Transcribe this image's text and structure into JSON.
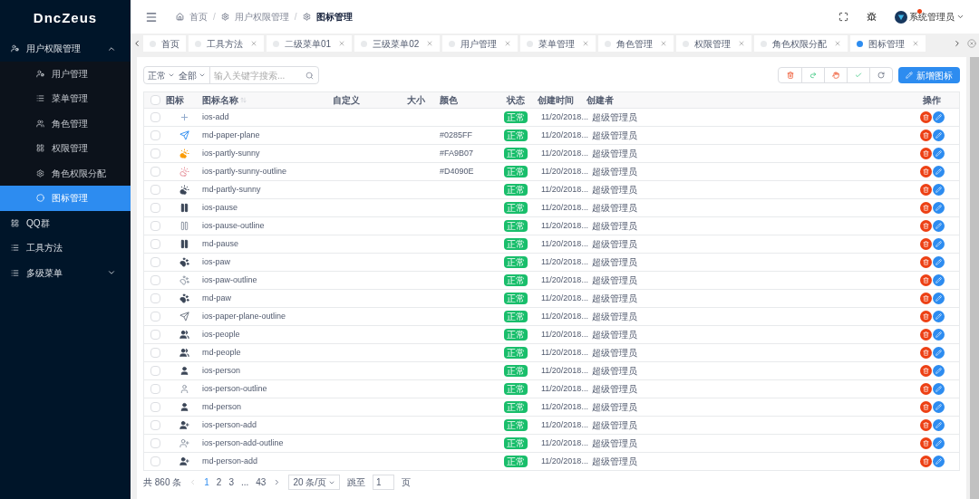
{
  "app": {
    "logo": "DncZeus"
  },
  "sidebar": {
    "items": [
      {
        "label": "用户权限管理",
        "expanded": true,
        "selected": false,
        "children": [
          {
            "label": "用户管理",
            "selected": false
          },
          {
            "label": "菜单管理",
            "selected": false
          },
          {
            "label": "角色管理",
            "selected": false
          },
          {
            "label": "权限管理",
            "selected": false
          },
          {
            "label": "角色权限分配",
            "selected": false
          },
          {
            "label": "图标管理",
            "selected": true
          }
        ]
      },
      {
        "label": "QQ群",
        "selected": false
      },
      {
        "label": "工具方法",
        "selected": false
      },
      {
        "label": "多级菜单",
        "expanded": false,
        "selected": false
      }
    ]
  },
  "header": {
    "breadcrumbs": [
      "首页",
      "用户权限管理",
      "图标管理"
    ],
    "separators": [
      "/",
      "/"
    ],
    "user": "系统管理员",
    "has_notification": true
  },
  "tabs": [
    {
      "label": "首页",
      "selected": false,
      "closable": false
    },
    {
      "label": "工具方法",
      "selected": false,
      "closable": true
    },
    {
      "label": "二级菜单01",
      "selected": false,
      "closable": true
    },
    {
      "label": "三级菜单02",
      "selected": false,
      "closable": true
    },
    {
      "label": "用户管理",
      "selected": false,
      "closable": true
    },
    {
      "label": "菜单管理",
      "selected": false,
      "closable": true
    },
    {
      "label": "角色管理",
      "selected": false,
      "closable": true
    },
    {
      "label": "权限管理",
      "selected": false,
      "closable": true
    },
    {
      "label": "角色权限分配",
      "selected": false,
      "closable": true
    },
    {
      "label": "图标管理",
      "selected": true,
      "closable": true
    }
  ],
  "filters": {
    "status": "正常",
    "scope": "全部",
    "search": {
      "placeholder": "输入关键字搜索..."
    }
  },
  "toolbar": {
    "add_button": "新增图标"
  },
  "table": {
    "select_all": {
      "checked": false
    },
    "columns": [
      "图标",
      "图标名称",
      "自定义",
      "大小",
      "颜色",
      "状态",
      "创建时间",
      "创建者",
      "操作"
    ],
    "rows": [
      {
        "checked": false,
        "name": "ios-add",
        "status": "正常",
        "created": "11/20/2018...",
        "creator": "超级管理员"
      },
      {
        "checked": false,
        "name": "md-paper-plane",
        "color_value": "#0285FF",
        "status": "正常",
        "created": "11/20/2018...",
        "creator": "超级管理员"
      },
      {
        "checked": false,
        "name": "ios-partly-sunny",
        "color_value": "#FA9B07",
        "status": "正常",
        "created": "11/20/2018...",
        "creator": "超级管理员"
      },
      {
        "checked": false,
        "name": "ios-partly-sunny-outline",
        "color_value": "#D4090E",
        "status": "正常",
        "created": "11/20/2018...",
        "creator": "超级管理员"
      },
      {
        "checked": false,
        "name": "md-partly-sunny",
        "status": "正常",
        "created": "11/20/2018...",
        "creator": "超级管理员"
      },
      {
        "checked": false,
        "name": "ios-pause",
        "status": "正常",
        "created": "11/20/2018...",
        "creator": "超级管理员"
      },
      {
        "checked": false,
        "name": "ios-pause-outline",
        "status": "正常",
        "created": "11/20/2018...",
        "creator": "超级管理员"
      },
      {
        "checked": false,
        "name": "md-pause",
        "status": "正常",
        "created": "11/20/2018...",
        "creator": "超级管理员"
      },
      {
        "checked": false,
        "name": "ios-paw",
        "status": "正常",
        "created": "11/20/2018...",
        "creator": "超级管理员"
      },
      {
        "checked": false,
        "name": "ios-paw-outline",
        "status": "正常",
        "created": "11/20/2018...",
        "creator": "超级管理员"
      },
      {
        "checked": false,
        "name": "md-paw",
        "status": "正常",
        "created": "11/20/2018...",
        "creator": "超级管理员"
      },
      {
        "checked": false,
        "name": "ios-paper-plane-outline",
        "status": "正常",
        "created": "11/20/2018...",
        "creator": "超级管理员"
      },
      {
        "checked": false,
        "name": "ios-people",
        "status": "正常",
        "created": "11/20/2018...",
        "creator": "超级管理员"
      },
      {
        "checked": false,
        "name": "md-people",
        "status": "正常",
        "created": "11/20/2018...",
        "creator": "超级管理员"
      },
      {
        "checked": false,
        "name": "ios-person",
        "status": "正常",
        "created": "11/20/2018...",
        "creator": "超级管理员"
      },
      {
        "checked": false,
        "name": "ios-person-outline",
        "status": "正常",
        "created": "11/20/2018...",
        "creator": "超级管理员"
      },
      {
        "checked": false,
        "name": "md-person",
        "status": "正常",
        "created": "11/20/2018...",
        "creator": "超级管理员"
      },
      {
        "checked": false,
        "name": "ios-person-add",
        "status": "正常",
        "created": "11/20/2018...",
        "creator": "超级管理员"
      },
      {
        "checked": false,
        "name": "ios-person-add-outline",
        "status": "正常",
        "created": "11/20/2018...",
        "creator": "超级管理员"
      },
      {
        "checked": false,
        "name": "md-person-add",
        "status": "正常",
        "created": "11/20/2018...",
        "creator": "超级管理员"
      }
    ]
  },
  "pagination": {
    "total": "共 860 条",
    "pages": [
      {
        "label": "1",
        "selected": true
      },
      {
        "label": "2",
        "selected": false
      },
      {
        "label": "3",
        "selected": false
      },
      {
        "label": "...",
        "selected": false
      },
      {
        "label": "43",
        "selected": false
      }
    ],
    "page_size": "20 条/页",
    "jump_label": "跳至",
    "jump_value": "1",
    "jump_suffix": "页"
  }
}
